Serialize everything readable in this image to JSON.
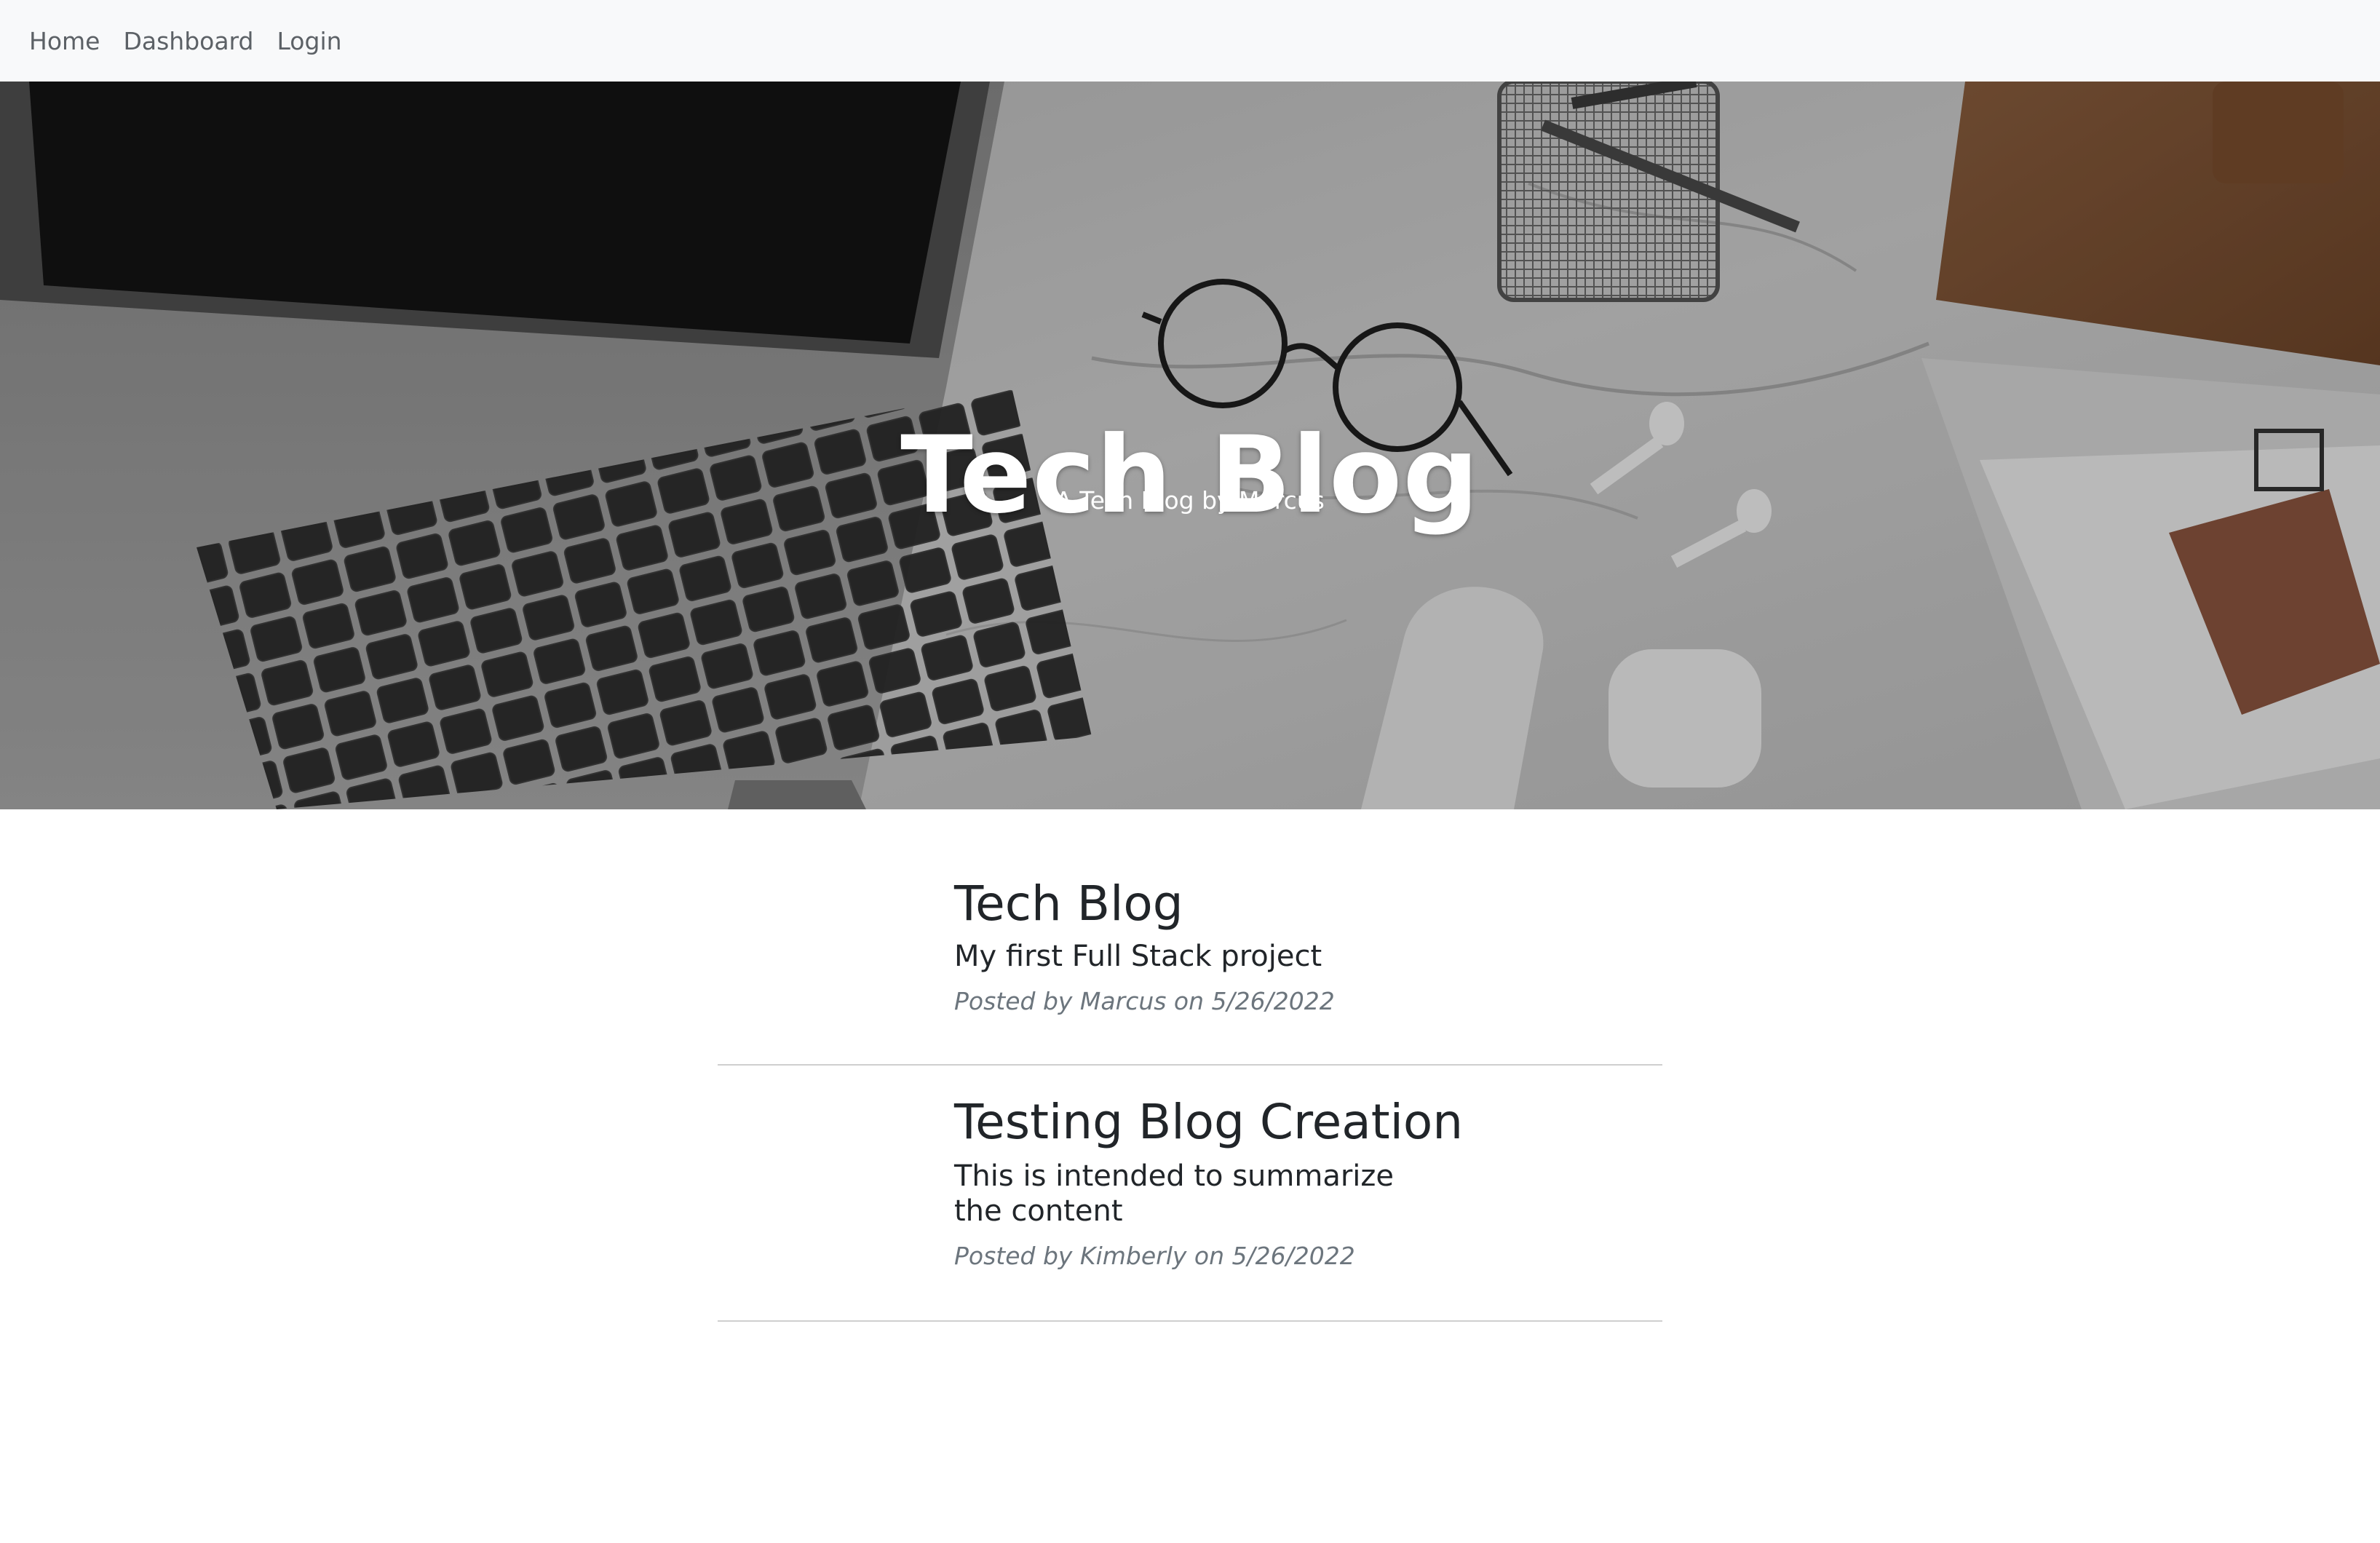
{
  "navbar": {
    "items": [
      {
        "label": "Home"
      },
      {
        "label": "Dashboard"
      },
      {
        "label": "Login"
      }
    ]
  },
  "hero": {
    "title": "Tech Blog",
    "subtitle": "A Tech Blog by Marcus"
  },
  "posts": [
    {
      "title": "Tech Blog",
      "summary": "My first Full Stack project",
      "meta": "Posted by Marcus on 5/26/2022"
    },
    {
      "title": "Testing Blog Creation",
      "summary": "This is intended to summarize the content",
      "meta": "Posted by Kimberly on 5/26/2022"
    }
  ],
  "colors": {
    "navbar_bg": "#f8f9fa",
    "nav_link": "#5c6166",
    "text": "#212529",
    "muted": "#6c757d",
    "divider": "#cfcfcf"
  }
}
